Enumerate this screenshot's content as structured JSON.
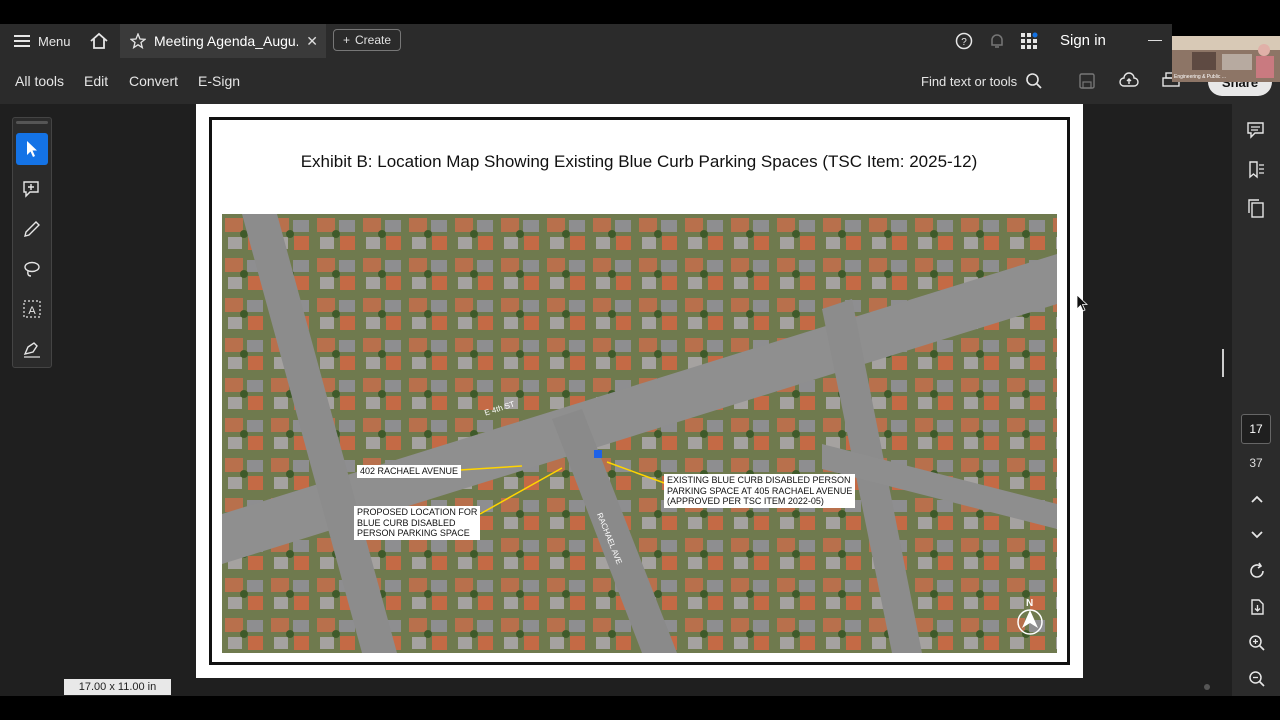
{
  "topbar": {
    "menu_label": "Menu",
    "tab_title": "Meeting Agenda_Augu...",
    "create_label": "Create",
    "sign_in_label": "Sign in"
  },
  "toolbar": {
    "all_tools": "All tools",
    "edit": "Edit",
    "convert": "Convert",
    "esign": "E-Sign",
    "find_text": "Find text or tools",
    "share": "Share"
  },
  "video": {
    "label": "Engineering & Public ..."
  },
  "document": {
    "title": "Exhibit B: Location Map Showing Existing Blue Curb Parking Spaces (TSC Item: 2025-12)",
    "labels": {
      "address_402": "402 RACHAEL AVENUE",
      "proposed": "PROPOSED LOCATION FOR\nBLUE CURB DISABLED\nPERSON PARKING SPACE",
      "existing": "EXISTING BLUE CURB DISABLED PERSON\nPARKING SPACE AT 405 RACHAEL AVENUE\n(APPROVED PER TSC ITEM 2022-05)",
      "street_e4th": "E 4th ST",
      "street_rachael": "RACHAEL AVE",
      "north": "N"
    }
  },
  "navigation": {
    "current_page": "17",
    "total_pages": "37"
  },
  "status": {
    "page_size": "17.00 x 11.00 in"
  },
  "colors": {
    "accent": "#1473e6",
    "chrome": "#2b2b2b",
    "canvas": "#1f1f1f"
  }
}
